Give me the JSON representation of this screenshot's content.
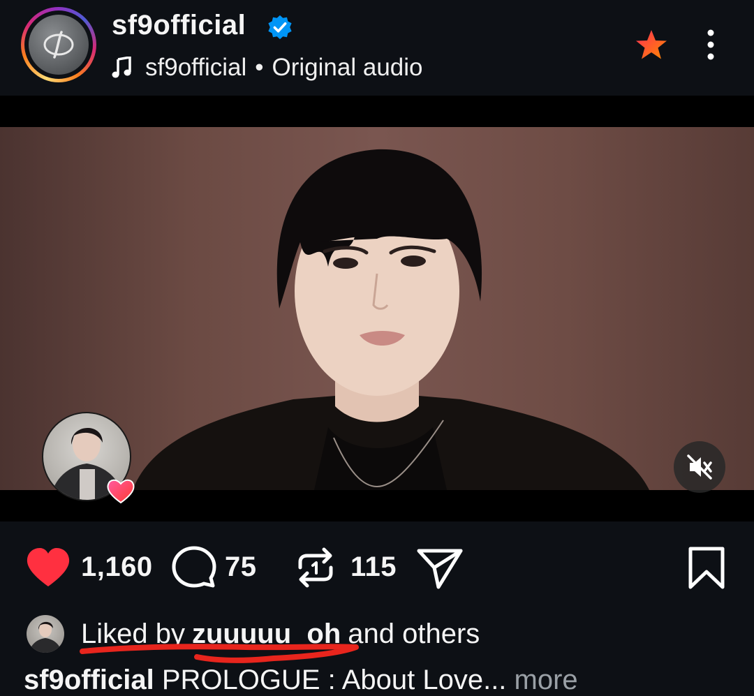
{
  "post_header": {
    "username": "sf9official",
    "verified": true,
    "audio_owner": "sf9official",
    "audio_separator": "•",
    "audio_title": "Original audio"
  },
  "video": {
    "muted": true
  },
  "actions": {
    "likes": "1,160",
    "comments": "75",
    "reposts": "115"
  },
  "liked_by": {
    "prefix": "Liked by",
    "user": "zuuuuu_oh",
    "suffix": "and others"
  },
  "caption": {
    "username": "sf9official",
    "text": "PROLOGUE : About Love...",
    "more": "more"
  },
  "colors": {
    "background": "#0d1015",
    "like_red": "#ff3040",
    "verified_blue": "#0095f6",
    "annotation_red": "#e8251d"
  },
  "icons": [
    "music-note-icon",
    "verified-badge-icon",
    "star-icon",
    "more-vertical-icon",
    "mute-icon",
    "heart-icon",
    "comment-icon",
    "repost-icon",
    "share-icon",
    "bookmark-icon"
  ]
}
